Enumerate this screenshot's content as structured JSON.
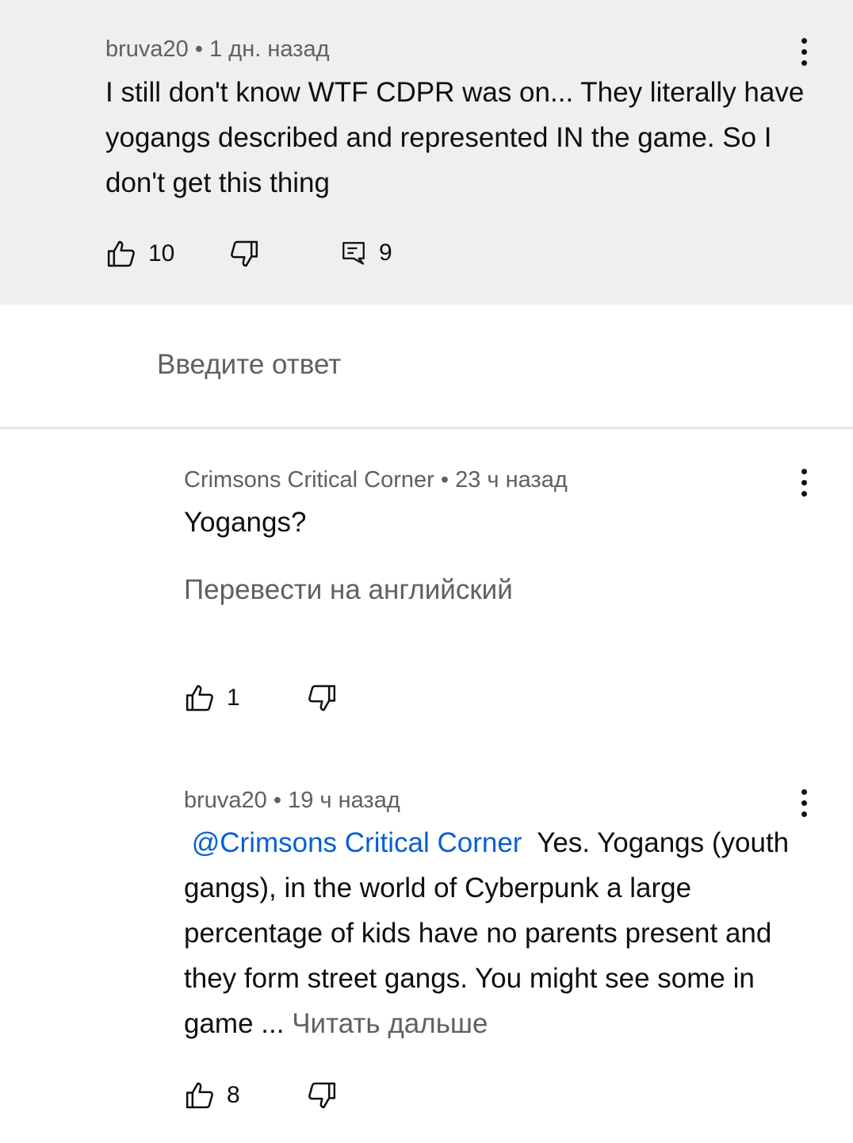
{
  "comment": {
    "author": "bruva20",
    "separator": "•",
    "time": "1 дн. назад",
    "text": "I still don't know WTF CDPR was on... They literally have yogangs described and represented IN the game. So I don't get this thing",
    "likes": "10",
    "replies": "9"
  },
  "reply_box": {
    "placeholder": "Введите ответ"
  },
  "reply1": {
    "author": "Crimsons Critical Corner",
    "separator": "•",
    "time": "23 ч назад",
    "text": "Yogangs?",
    "translate_label": "Перевести на английский",
    "likes": "1"
  },
  "reply2": {
    "author": "bruva20",
    "separator": "•",
    "time": "19 ч назад",
    "mention": "@Crimsons Critical Corner",
    "text": "Yes. Yogangs (youth gangs), in the world of Cyberpunk a large percentage of kids have no parents present and they form street gangs. You might see some in game ...",
    "read_more": "Читать дальше",
    "likes": "8"
  },
  "icons": {
    "like": "thumbs-up-icon",
    "dislike": "thumbs-down-icon",
    "reply": "comment-reply-icon",
    "more": "more-vertical-icon"
  },
  "colors": {
    "highlight_bg": "#efefef",
    "secondary_text": "#606060",
    "link": "#065fd4"
  }
}
